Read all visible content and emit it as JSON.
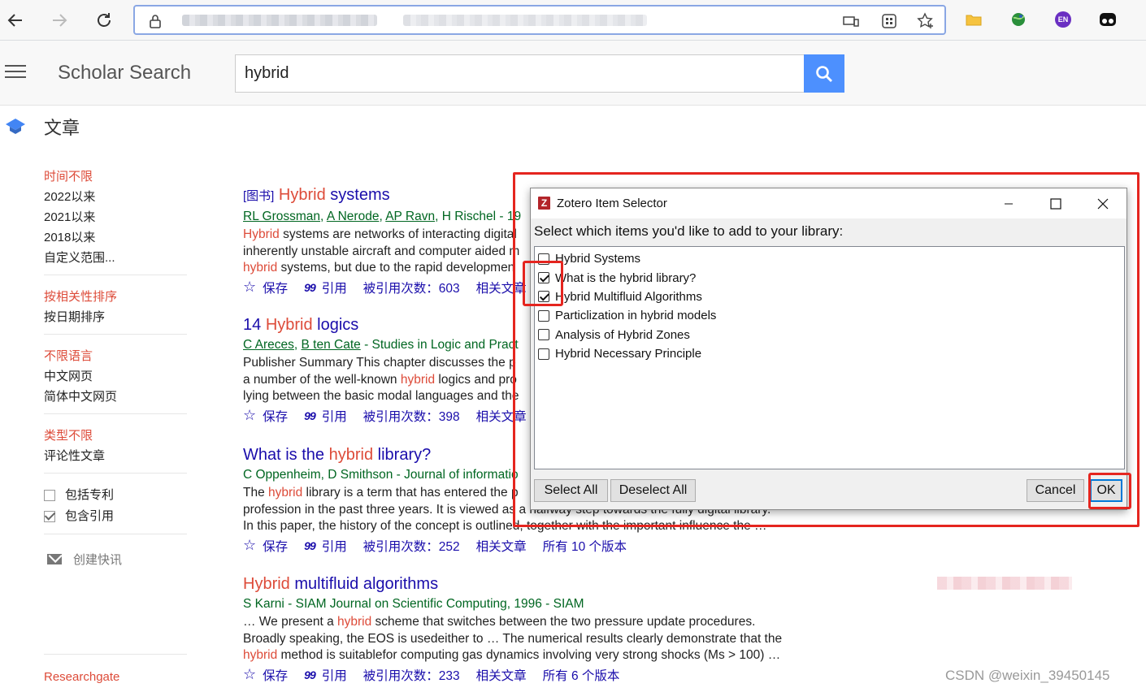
{
  "browser": {
    "nav": {
      "back": "back-arrow",
      "forward": "forward-arrow",
      "reload": "reload"
    },
    "extensions": [
      "folder-icon",
      "globe-icon",
      "en-icon",
      "panda-icon"
    ],
    "ext_en_label": "EN"
  },
  "header": {
    "brand": "Scholar Search",
    "search_value": "hybrid",
    "section_title": "文章"
  },
  "sidebar": {
    "time": [
      "时间不限",
      "2022以来",
      "2021以来",
      "2018以来",
      "自定义范围..."
    ],
    "sort": [
      "按相关性排序",
      "按日期排序"
    ],
    "language": [
      "不限语言",
      "中文网页",
      "简体中文网页"
    ],
    "type": [
      "类型不限",
      "评论性文章"
    ],
    "checks": [
      {
        "label": "包括专利",
        "checked": false
      },
      {
        "label": "包含引用",
        "checked": true
      }
    ],
    "alert": "创建快讯",
    "source": "Researchgate"
  },
  "results": [
    {
      "tag": "[图书]",
      "title_hl": "Hybrid",
      "title_rest": " systems",
      "authors": [
        "RL Grossman",
        "A Nerode",
        "AP Ravn",
        "H Rischel - 19"
      ],
      "snippet": [
        {
          "hl": "Hybrid",
          "text": " systems are networks of interacting digital"
        },
        {
          "hl": "",
          "text": "inherently unstable aircraft and computer aided m"
        },
        {
          "hl": "hybrid",
          "text": " systems, but due to the rapid developmen"
        }
      ],
      "save": "保存",
      "cite": "引用",
      "cited": "被引用次数：603",
      "related": "相关文章"
    },
    {
      "tag": "",
      "title_pre": "14 ",
      "title_hl": "Hybrid",
      "title_rest": " logics",
      "authors": [
        "C Areces",
        "B ten Cate",
        " - Studies in Logic and Pract"
      ],
      "snippet": [
        {
          "hl": "",
          "text": "Publisher Summary This chapter discusses the p"
        },
        {
          "pre": "a number of the well-known ",
          "hl": "hybrid",
          "text": " logics and pro"
        },
        {
          "hl": "",
          "text": "lying between the basic modal languages and the"
        }
      ],
      "save": "保存",
      "cite": "引用",
      "cited": "被引用次数：398",
      "related": "相关文章"
    },
    {
      "title_pre": "What is the ",
      "title_hl": "hybrid",
      "title_rest": " library?",
      "authors_text": "C Oppenheim, D Smithson - Journal of informatio",
      "snippet": [
        {
          "pre": "The ",
          "hl": "hybrid",
          "text": " library is a term that has entered the p"
        },
        {
          "hl": "",
          "text": "profession in the past three years. It is viewed as a halfway step towards the fully digital library."
        },
        {
          "hl": "",
          "text": "In this paper, the history of the concept is outlined, together with the important influence the …"
        }
      ],
      "save": "保存",
      "cite": "引用",
      "cited": "被引用次数：252",
      "related": "相关文章",
      "versions": "所有 10 个版本"
    },
    {
      "title_hl": "Hybrid",
      "title_rest": " multifluid algorithms",
      "authors_text": "S Karni - SIAM Journal on Scientific Computing, 1996 - SIAM",
      "snippet": [
        {
          "pre": "… We present a ",
          "hl": "hybrid",
          "text": " scheme that switches between the two pressure update procedures."
        },
        {
          "hl": "",
          "text": "Broadly speaking, the EOS is usedeither to … The numerical results clearly demonstrate that the"
        },
        {
          "hl": "hybrid",
          "text": " method is suitablefor computing gas dynamics involving very strong shocks (Ms > 100) …"
        }
      ],
      "save": "保存",
      "cite": "引用",
      "cited": "被引用次数：233",
      "related": "相关文章",
      "versions": "所有 6 个版本"
    }
  ],
  "dialog": {
    "title": "Zotero Item Selector",
    "logo_letter": "Z",
    "prompt": "Select which items you'd like to add to your library:",
    "items": [
      {
        "label": "Hybrid Systems",
        "checked": false
      },
      {
        "label": "What is the hybrid library?",
        "checked": true
      },
      {
        "label": "Hybrid Multifluid Algorithms",
        "checked": true
      },
      {
        "label": "Particlization in hybrid models",
        "checked": false
      },
      {
        "label": "Analysis of Hybrid Zones",
        "checked": false
      },
      {
        "label": "Hybrid Necessary Principle",
        "checked": false
      }
    ],
    "select_all": "Select All",
    "deselect_all": "Deselect All",
    "cancel": "Cancel",
    "ok": "OK"
  },
  "watermark": "CSDN @weixin_39450145",
  "colors": {
    "accent_red": "#dd4b39",
    "link_blue": "#1a0dab",
    "author_green": "#006621",
    "annotation_red": "#e5251f",
    "search_blue": "#4d90fe"
  }
}
